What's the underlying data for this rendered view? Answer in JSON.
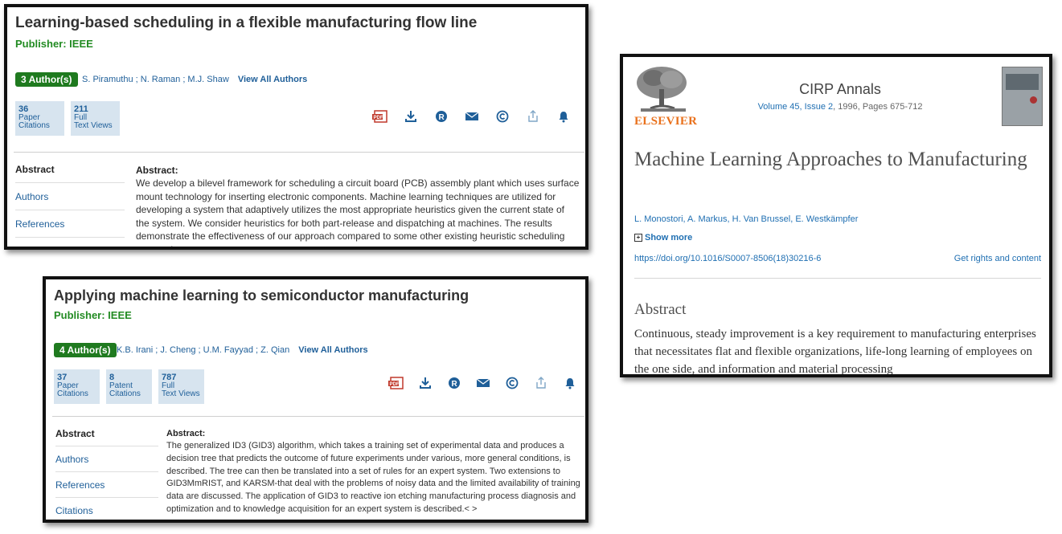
{
  "paper1": {
    "title": "Learning-based scheduling in a flexible manufacturing flow line",
    "publisher": "Publisher: IEEE",
    "authors_badge": "3 Author(s)",
    "authors": "S. Piramuthu ; N. Raman ; M.J. Shaw",
    "view_all": "View All Authors",
    "metrics": [
      {
        "value": "36",
        "label": "Paper\nCitations"
      },
      {
        "value": "211",
        "label": "Full\nText Views"
      }
    ],
    "sidebar": [
      "Abstract",
      "Authors",
      "References"
    ],
    "abstract_heading": "Abstract:",
    "abstract": "We develop a bilevel framework for scheduling a circuit board (PCB) assembly plant which uses surface mount technology for inserting electronic components. Machine learning techniques are utilized for developing a system that adaptively utilizes the most appropriate heuristics given the current state of the system. We consider heuristics for both part-release and dispatching at machines. The results demonstrate the effectiveness of our approach compared to some other existing heuristic scheduling approaches.< >"
  },
  "paper2": {
    "title": "Applying machine learning to semiconductor manufacturing",
    "publisher": "Publisher: IEEE",
    "authors_badge": "4 Author(s)",
    "authors": "K.B. Irani ; J. Cheng ; U.M. Fayyad ; Z. Qian",
    "view_all": "View All Authors",
    "metrics": [
      {
        "value": "37",
        "label": "Paper\nCitations"
      },
      {
        "value": "8",
        "label": "Patent\nCitations"
      },
      {
        "value": "787",
        "label": "Full\nText Views"
      }
    ],
    "sidebar": [
      "Abstract",
      "Authors",
      "References",
      "Citations"
    ],
    "abstract_heading": "Abstract:",
    "abstract": "The generalized ID3 (GID3) algorithm, which takes a training set of experimental data and produces a decision tree that predicts the outcome of future experiments under various, more general conditions, is described. The tree can then be translated into a set of rules for an expert system. Two extensions to GID3MmRIST, and KARSM-that deal with the problems of noisy data and the limited availability of training data are discussed. The application of GID3 to reactive ion etching manufacturing process diagnosis and optimization and to knowledge acquisition for an expert system is described.< >"
  },
  "paper3": {
    "publisher_logo_text": "ELSEVIER",
    "journal": "CIRP Annals",
    "volume_link": "Volume 45, Issue 2",
    "volume_rest": ", 1996, Pages 675-712",
    "title": "Machine Learning Approaches to Manufacturing",
    "authors": "L. Monostori, A. Markus, H. Van Brussel, E. Westkämpfer",
    "show_more": "Show more",
    "doi": "https://doi.org/10.1016/S0007-8506(18)30216-6",
    "rights": "Get rights and content",
    "abstract_heading": "Abstract",
    "abstract": "Continuous, steady improvement is a key requirement to manufacturing enterprises that necessitates flat and flexible organizations, life-long learning of employees on the one side, and information and material processing"
  },
  "icons": [
    "pdf-icon",
    "download-icon",
    "rights-icon",
    "email-icon",
    "copyright-icon",
    "share-icon",
    "alert-bell-icon"
  ],
  "colors": {
    "publisher_green": "#228b22",
    "badge_green": "#1f7a1f",
    "link_blue": "#1f5f99",
    "elsevier_orange": "#e9711c"
  }
}
